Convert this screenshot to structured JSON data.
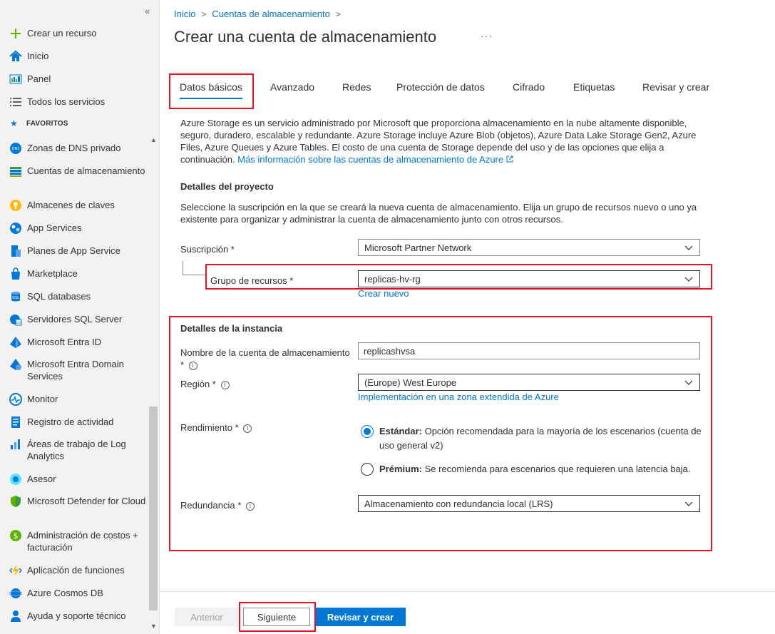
{
  "sidebar": {
    "collapse_glyph": "«",
    "top_items": [
      {
        "label": "Crear un recurso",
        "icon": "plus-icon"
      },
      {
        "label": "Inicio",
        "icon": "home-icon"
      },
      {
        "label": "Panel",
        "icon": "dashboard-icon"
      },
      {
        "label": "Todos los servicios",
        "icon": "list-icon"
      }
    ],
    "favorites_label": "FAVORITOS",
    "favorites": [
      {
        "label": "Zonas de DNS privado",
        "icon": "dns-icon"
      },
      {
        "label": "Cuentas de almacenamiento",
        "icon": "storage-icon"
      },
      {
        "label": "Almacenes de claves",
        "icon": "key-vault-icon"
      },
      {
        "label": "App Services",
        "icon": "app-services-icon"
      },
      {
        "label": "Planes de App Service",
        "icon": "app-service-plan-icon"
      },
      {
        "label": "Marketplace",
        "icon": "marketplace-icon"
      },
      {
        "label": "SQL databases",
        "icon": "sql-database-icon"
      },
      {
        "label": "Servidores SQL Server",
        "icon": "sql-server-icon"
      },
      {
        "label": "Microsoft Entra ID",
        "icon": "entra-id-icon"
      },
      {
        "label": "Microsoft Entra Domain Services",
        "icon": "entra-domain-icon"
      },
      {
        "label": "Monitor",
        "icon": "monitor-icon"
      },
      {
        "label": "Registro de actividad",
        "icon": "activity-log-icon"
      },
      {
        "label": "Áreas de trabajo de Log Analytics",
        "icon": "log-analytics-icon"
      },
      {
        "label": "Asesor",
        "icon": "advisor-icon"
      },
      {
        "label": "Microsoft Defender for Cloud",
        "icon": "defender-icon"
      },
      {
        "label": "Administración de costos + facturación",
        "icon": "cost-icon"
      },
      {
        "label": "Aplicación de funciones",
        "icon": "function-app-icon"
      },
      {
        "label": "Azure Cosmos DB",
        "icon": "cosmos-db-icon"
      },
      {
        "label": "Ayuda y soporte técnico",
        "icon": "help-support-icon"
      }
    ]
  },
  "breadcrumb": {
    "items": [
      "Inicio",
      "Cuentas de almacenamiento"
    ],
    "separator": ">"
  },
  "page": {
    "title": "Crear una cuenta de almacenamiento",
    "more": "···"
  },
  "tabs": [
    "Datos básicos",
    "Avanzado",
    "Redes",
    "Protección de datos",
    "Cifrado",
    "Etiquetas",
    "Revisar y crear"
  ],
  "intro": {
    "text": "Azure Storage es un servicio administrado por Microsoft que proporciona almacenamiento en la nube altamente disponible, seguro, duradero, escalable y redundante. Azure Storage incluye Azure Blob (objetos), Azure Data Lake Storage Gen2, Azure Files, Azure Queues y Azure Tables. El costo de una cuenta de Storage depende del uso y de las opciones que elija a continuación.",
    "link": "Más información sobre las cuentas de almacenamiento de Azure"
  },
  "project": {
    "title": "Detalles del proyecto",
    "description": "Seleccione la suscripción en la que se creará la nueva cuenta de almacenamiento. Elija un grupo de recursos nuevo o uno ya existente para organizar y administrar la cuenta de almacenamiento junto con otros recursos.",
    "subscription_label": "Suscripción *",
    "subscription_value": "Microsoft Partner Network",
    "resource_group_label": "Grupo de recursos *",
    "resource_group_value": "replicas-hv-rg",
    "create_new": "Crear nuevo"
  },
  "instance": {
    "title": "Detalles de la instancia",
    "name_label_line1": "Nombre de la cuenta de almacenamiento",
    "name_label_line2": "*",
    "name_value": "replicashvsa",
    "region_label": "Región *",
    "region_value": "(Europe) West Europe",
    "edge_zone_link": "Implementación en una zona extendida de Azure",
    "performance_label": "Rendimiento *",
    "performance_options": [
      {
        "title": "Estándar:",
        "text": "Opción recomendada para la mayoría de los escenarios (cuenta de uso general v2)",
        "checked": true
      },
      {
        "title": "Prémium:",
        "text": "Se recomienda para escenarios que requieren una latencia baja.",
        "checked": false
      }
    ],
    "redundancy_label": "Redundancia *",
    "redundancy_value": "Almacenamiento con redundancia local (LRS)"
  },
  "footer": {
    "previous": "Anterior",
    "next": "Siguiente",
    "review": "Revisar y crear"
  },
  "info_glyph": "i",
  "colors": {
    "accent": "#0078d4",
    "highlight_box": "#e81123",
    "sidebar_bg": "#f3f2f1"
  }
}
